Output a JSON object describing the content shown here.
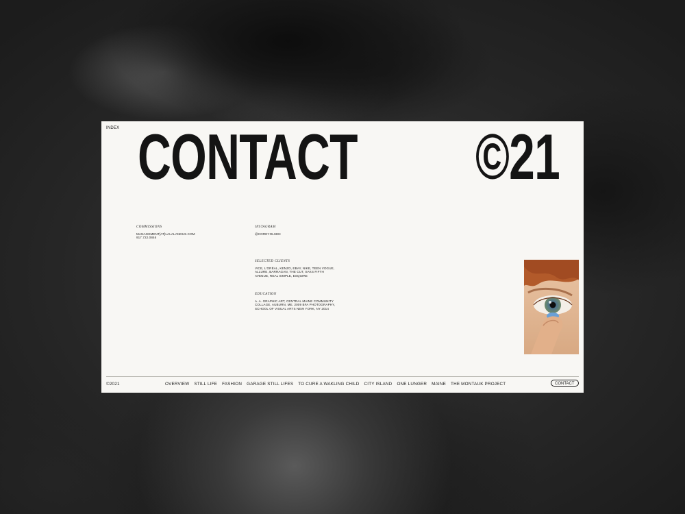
{
  "header": {
    "index_label": "INDEX",
    "title": "CONTACT",
    "copyright_big": "©21"
  },
  "commissions": {
    "label": "COMMISSIONS",
    "email": "MANAGEMENT[AT]LALALANDUS.COM",
    "phone": "917.722.0846"
  },
  "instagram": {
    "label": "INSTAGRAM",
    "handle": "@COREYOLSEN"
  },
  "clients": {
    "label": "SELECTED CLIENTS",
    "list": "VICE, L'ORÉAL, KENZO, EBAY, NIKE, TEEN VOGUE, ALLURE, BARRAGAN, THE CUT, SAKS FIFTH AVENUE, REAL SIMPLE, ESQUIRE"
  },
  "education": {
    "label": "EDUCATION",
    "text": "A. A. GRAPHIC ART, CENTRAL MAINE COMMUNITY COLLAGE, AUBURN, ME. 2009 BFA PHOTOGRAPHY, SCHOOL OF VISUAL ARTS NEW YORK, NY 2014"
  },
  "footer": {
    "copyright": "©2021",
    "nav": [
      "OVERVIEW",
      "STILL LIFE",
      "FASHION",
      "GARAGE STILL LIFES",
      "TO CURE A WAKLING CHILD",
      "CITY ISLAND",
      "ONE LUNGER",
      "MAINE",
      "THE MONTAUK PROJECT"
    ],
    "contact_button": "CONTACT"
  },
  "colors": {
    "card_background": "#f8f7f4",
    "text": "#141414",
    "page_background": "#2c2c2c"
  },
  "icons": {
    "photo": "eye-contact-lens-photo"
  }
}
